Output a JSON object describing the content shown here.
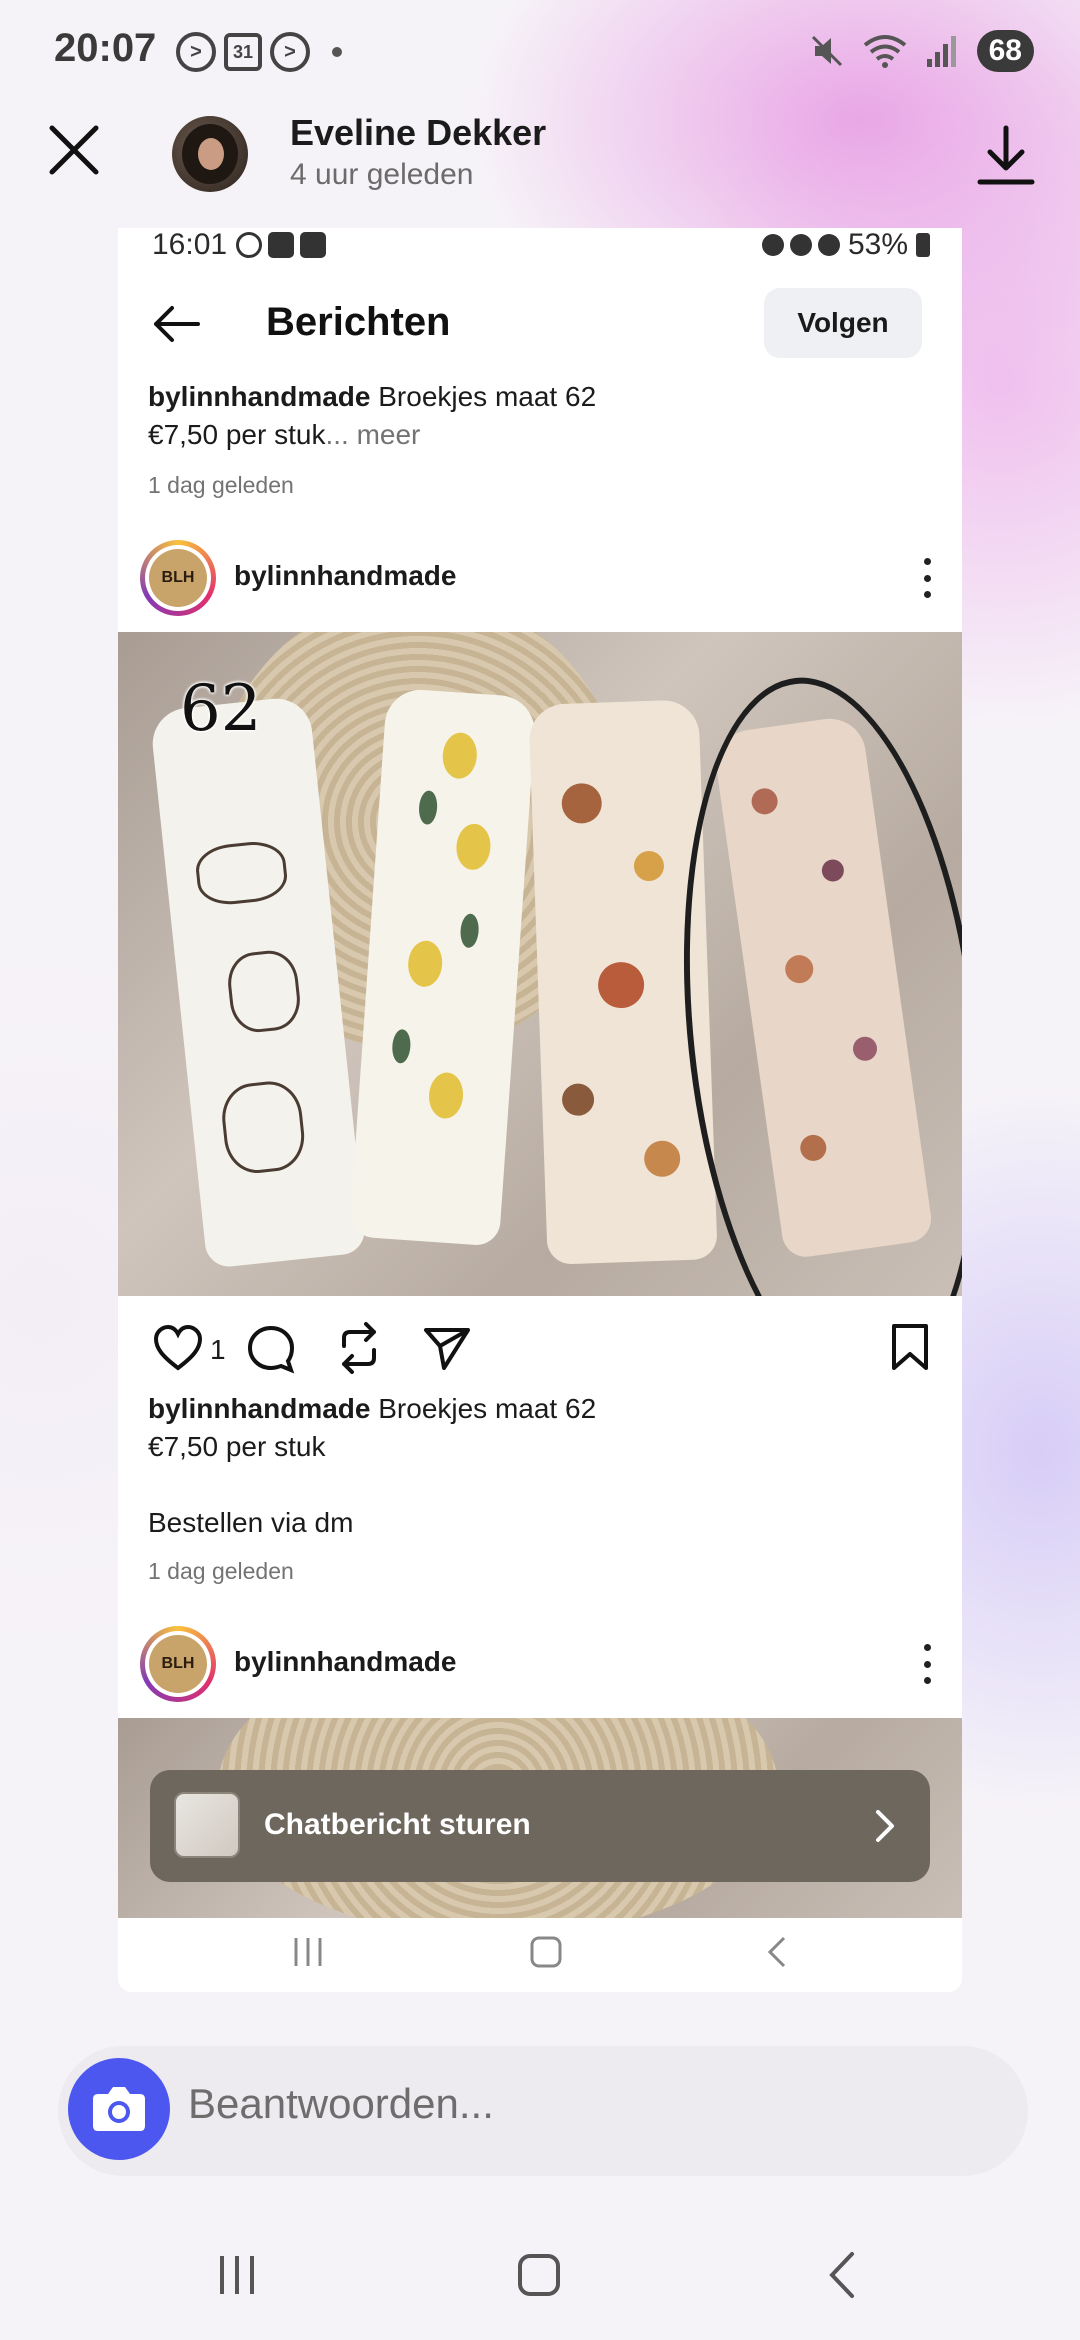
{
  "status_bar": {
    "time": "20:07",
    "calendar_badge": "31",
    "battery": "68"
  },
  "story": {
    "user_name": "Eveline Dekker",
    "posted_ago": "4 uur geleden"
  },
  "screenshot": {
    "status_time": "16:01",
    "status_battery": "53%",
    "nav_title": "Berichten",
    "follow_label": "Volgen",
    "prev_caption": {
      "user": "bylinnhandmade",
      "text_line1": " Broekjes maat 62",
      "text_line2": "€7,50 per stuk",
      "more": "... meer"
    },
    "prev_ago": "1 dag geleden",
    "post": {
      "user": "bylinnhandmade",
      "avatar_logo": "BLH",
      "photo_number": "62",
      "likes": "1",
      "caption_user": "bylinnhandmade",
      "caption_line1": " Broekjes maat 62",
      "caption_line2": "€7,50 per stuk",
      "caption_line3": "Bestellen via dm",
      "ago": "1 dag geleden"
    },
    "next_post": {
      "user": "bylinnhandmade",
      "avatar_logo": "BLH"
    },
    "chat_cta": "Chatbericht sturen"
  },
  "reply": {
    "placeholder": "Beantwoorden..."
  },
  "icons": {
    "close": "close-icon",
    "download": "download-icon",
    "back": "back-arrow-icon",
    "like": "heart-icon",
    "comment": "comment-icon",
    "repost": "repost-icon",
    "share": "send-icon",
    "save": "bookmark-icon",
    "camera": "camera-icon"
  },
  "colors": {
    "camera_button": "#4b57ef",
    "chat_bar": "#6e675e"
  }
}
